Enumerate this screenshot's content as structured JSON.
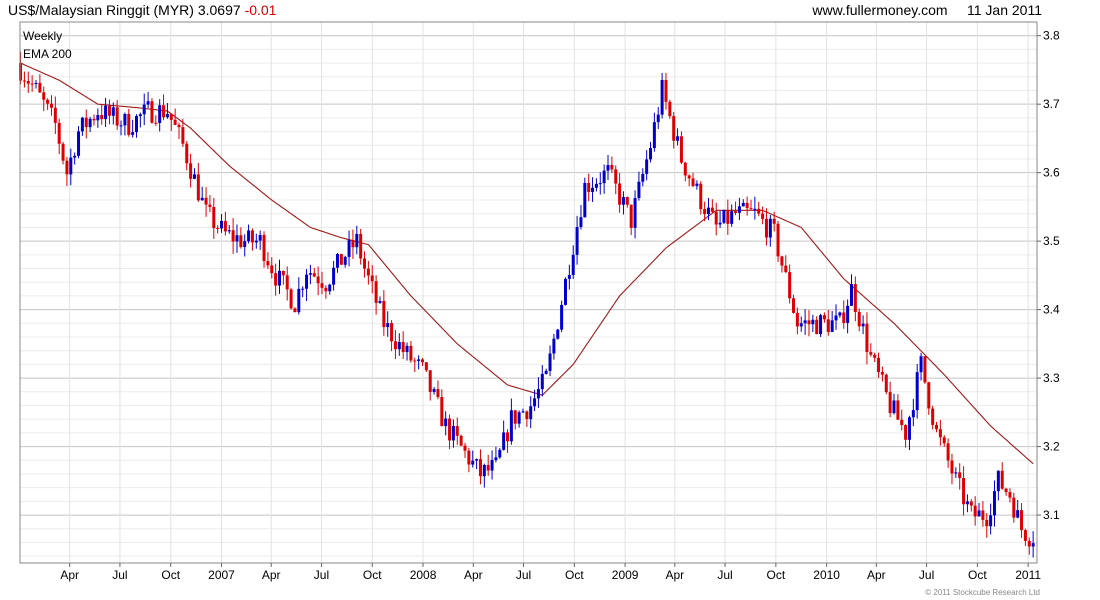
{
  "header": {
    "title": "US$/Malaysian Ringgit (MYR)",
    "last": "3.0697",
    "change": "-0.01",
    "site": "www.fullermoney.com",
    "date": "11 Jan 2011"
  },
  "legend": {
    "line1": "Weekly",
    "line2": "EMA 200"
  },
  "footer": {
    "copyright": "© 2011 Stockcube Research Ltd"
  },
  "colors": {
    "up": "#0000cc",
    "down": "#dd0000",
    "ema": "#a01818",
    "grid": "#cfcfcf"
  },
  "chart_data": {
    "type": "candlestick",
    "title": "US$/Malaysian Ringgit (MYR)",
    "y_axis_side": "right",
    "ylim": [
      3.03,
      3.82
    ],
    "y_ticks": [
      3.1,
      3.2,
      3.3,
      3.4,
      3.5,
      3.6,
      3.7,
      3.8
    ],
    "x_ticks": [
      {
        "label": "Apr",
        "date": "2006-04-01"
      },
      {
        "label": "Jul",
        "date": "2006-07-01"
      },
      {
        "label": "Oct",
        "date": "2006-10-01"
      },
      {
        "label": "2007",
        "date": "2007-01-01"
      },
      {
        "label": "Apr",
        "date": "2007-04-01"
      },
      {
        "label": "Jul",
        "date": "2007-07-01"
      },
      {
        "label": "Oct",
        "date": "2007-10-01"
      },
      {
        "label": "2008",
        "date": "2008-01-01"
      },
      {
        "label": "Apr",
        "date": "2008-04-01"
      },
      {
        "label": "Jul",
        "date": "2008-07-01"
      },
      {
        "label": "Oct",
        "date": "2008-10-01"
      },
      {
        "label": "2009",
        "date": "2009-01-01"
      },
      {
        "label": "Apr",
        "date": "2009-04-01"
      },
      {
        "label": "Jul",
        "date": "2009-07-01"
      },
      {
        "label": "Oct",
        "date": "2009-10-01"
      },
      {
        "label": "2010",
        "date": "2010-01-01"
      },
      {
        "label": "Apr",
        "date": "2010-04-01"
      },
      {
        "label": "Jul",
        "date": "2010-07-01"
      },
      {
        "label": "Oct",
        "date": "2010-10-01"
      },
      {
        "label": "2011",
        "date": "2011-01-01"
      }
    ],
    "x_range": [
      "2006-01-01",
      "2011-01-17"
    ],
    "grid": true,
    "price_anchors": [
      [
        "2006-01-02",
        3.76
      ],
      [
        "2006-02-06",
        3.72
      ],
      [
        "2006-03-13",
        3.67
      ],
      [
        "2006-04-03",
        3.6
      ],
      [
        "2006-04-24",
        3.66
      ],
      [
        "2006-05-29",
        3.69
      ],
      [
        "2006-07-24",
        3.67
      ],
      [
        "2006-08-28",
        3.69
      ],
      [
        "2006-10-02",
        3.69
      ],
      [
        "2006-10-30",
        3.64
      ],
      [
        "2006-12-11",
        3.54
      ],
      [
        "2007-01-15",
        3.51
      ],
      [
        "2007-02-19",
        3.5
      ],
      [
        "2007-03-19",
        3.5
      ],
      [
        "2007-04-16",
        3.45
      ],
      [
        "2007-05-21",
        3.41
      ],
      [
        "2007-06-11",
        3.46
      ],
      [
        "2007-07-16",
        3.44
      ],
      [
        "2007-08-20",
        3.48
      ],
      [
        "2007-09-10",
        3.5
      ],
      [
        "2007-09-24",
        3.46
      ],
      [
        "2007-10-29",
        3.38
      ],
      [
        "2007-12-03",
        3.34
      ],
      [
        "2008-01-07",
        3.31
      ],
      [
        "2008-02-18",
        3.23
      ],
      [
        "2008-03-24",
        3.19
      ],
      [
        "2008-04-21",
        3.16
      ],
      [
        "2008-05-19",
        3.17
      ],
      [
        "2008-06-16",
        3.24
      ],
      [
        "2008-07-21",
        3.26
      ],
      [
        "2008-08-18",
        3.3
      ],
      [
        "2008-09-22",
        3.44
      ],
      [
        "2008-10-27",
        3.58
      ],
      [
        "2008-12-08",
        3.6
      ],
      [
        "2009-01-19",
        3.53
      ],
      [
        "2009-02-23",
        3.64
      ],
      [
        "2009-03-16",
        3.72
      ],
      [
        "2009-04-20",
        3.62
      ],
      [
        "2009-05-25",
        3.56
      ],
      [
        "2009-06-22",
        3.52
      ],
      [
        "2009-07-27",
        3.54
      ],
      [
        "2009-08-31",
        3.54
      ],
      [
        "2009-10-05",
        3.51
      ],
      [
        "2009-11-16",
        3.38
      ],
      [
        "2009-12-21",
        3.38
      ],
      [
        "2010-02-01",
        3.38
      ],
      [
        "2010-02-22",
        3.43
      ],
      [
        "2010-03-29",
        3.33
      ],
      [
        "2010-05-03",
        3.26
      ],
      [
        "2010-05-31",
        3.22
      ],
      [
        "2010-06-28",
        3.32
      ],
      [
        "2010-07-26",
        3.22
      ],
      [
        "2010-08-30",
        3.15
      ],
      [
        "2010-09-27",
        3.1
      ],
      [
        "2010-10-25",
        3.1
      ],
      [
        "2010-11-15",
        3.15
      ],
      [
        "2010-12-06",
        3.13
      ],
      [
        "2010-12-27",
        3.08
      ],
      [
        "2011-01-10",
        3.07
      ]
    ],
    "ema_anchors": [
      [
        "2006-01-02",
        3.76
      ],
      [
        "2006-03-13",
        3.735
      ],
      [
        "2006-05-22",
        3.7
      ],
      [
        "2006-07-31",
        3.695
      ],
      [
        "2006-09-25",
        3.69
      ],
      [
        "2006-11-06",
        3.665
      ],
      [
        "2007-01-15",
        3.61
      ],
      [
        "2007-04-02",
        3.56
      ],
      [
        "2007-06-11",
        3.52
      ],
      [
        "2007-08-06",
        3.505
      ],
      [
        "2007-09-24",
        3.495
      ],
      [
        "2007-12-10",
        3.42
      ],
      [
        "2008-03-03",
        3.35
      ],
      [
        "2008-06-02",
        3.29
      ],
      [
        "2008-08-04",
        3.275
      ],
      [
        "2008-09-29",
        3.32
      ],
      [
        "2008-12-22",
        3.42
      ],
      [
        "2009-03-16",
        3.49
      ],
      [
        "2009-06-15",
        3.545
      ],
      [
        "2009-09-07",
        3.545
      ],
      [
        "2009-11-16",
        3.52
      ],
      [
        "2010-02-01",
        3.445
      ],
      [
        "2010-05-03",
        3.38
      ],
      [
        "2010-08-02",
        3.305
      ],
      [
        "2010-10-25",
        3.23
      ],
      [
        "2011-01-10",
        3.175
      ]
    ]
  }
}
